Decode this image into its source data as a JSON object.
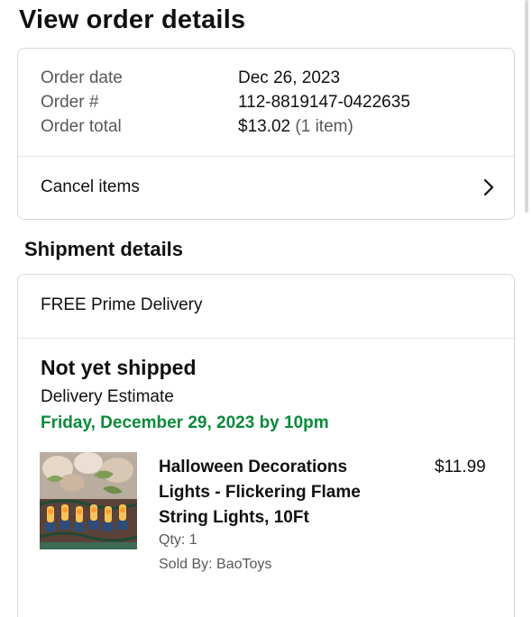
{
  "header": {
    "title": "View order details"
  },
  "order": {
    "rows": [
      {
        "label": "Order date",
        "value": "Dec 26, 2023"
      },
      {
        "label": "Order #",
        "value": "112-8819147-0422635"
      },
      {
        "label": "Order total",
        "value": "$13.02",
        "extra": "(1 item)"
      }
    ],
    "cancel_label": "Cancel items"
  },
  "shipment": {
    "section_title": "Shipment details",
    "delivery_type": "FREE Prime Delivery",
    "status": "Not yet shipped",
    "estimate_label": "Delivery Estimate",
    "estimate_date": "Friday, December 29, 2023 by 10pm",
    "item": {
      "title": "Halloween Decorations Lights - Flickering Flame String Lights, 10Ft",
      "price": "$11.99",
      "qty": "Qty: 1",
      "seller": "Sold By: BaoToys"
    }
  },
  "colors": {
    "estimate_green": "#0a8a3a",
    "border": "#d5d9d9",
    "muted_text": "#565959"
  }
}
